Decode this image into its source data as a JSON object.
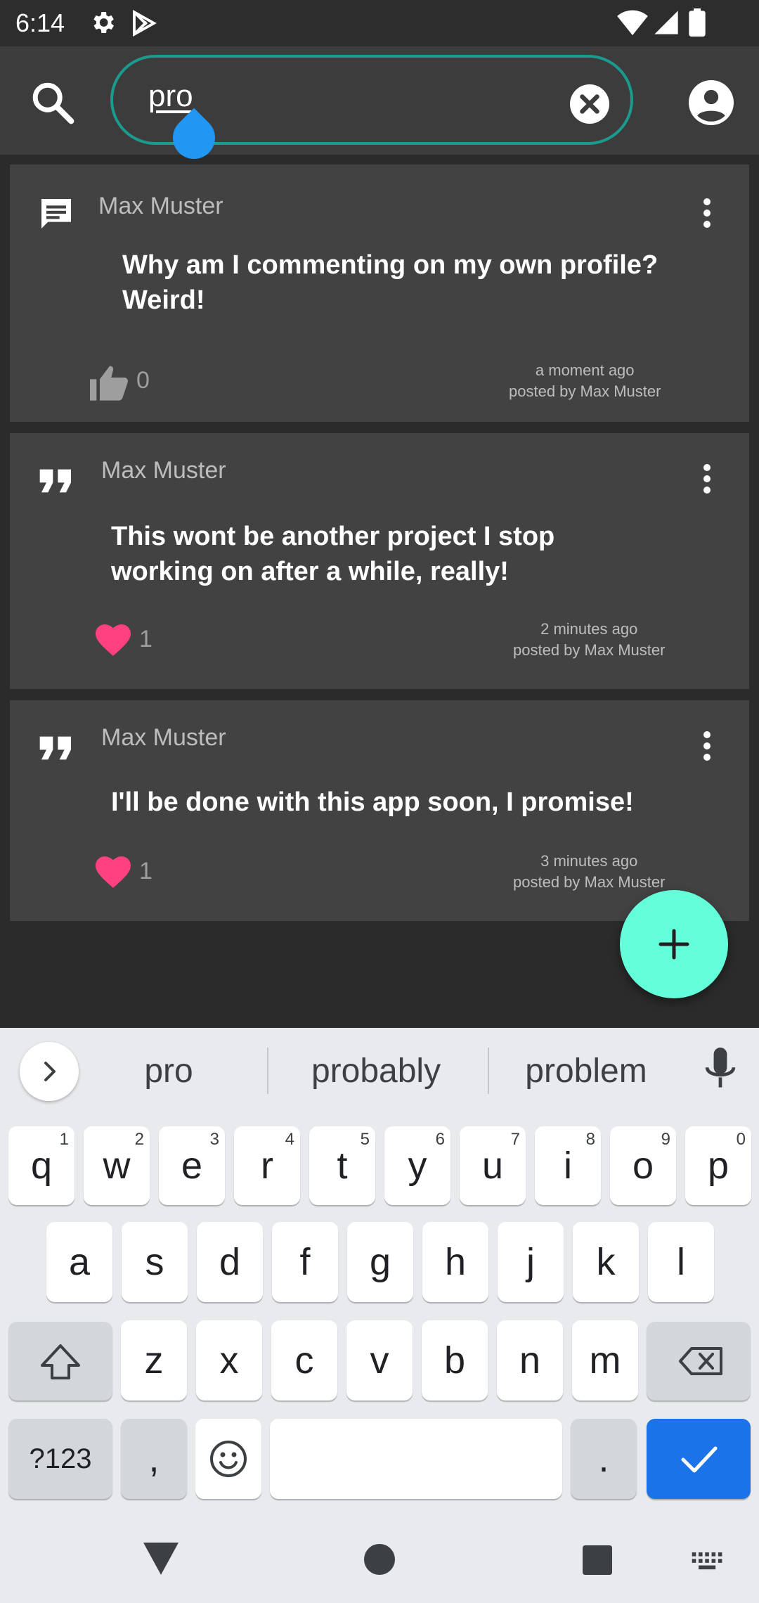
{
  "status_bar": {
    "time": "6:14"
  },
  "search": {
    "query": "pro"
  },
  "posts": [
    {
      "type_icon": "comment-icon",
      "author": "Max Muster",
      "body_line1": "Why am I commenting on my own profile?",
      "body_line2": "Weird!",
      "reaction_icon": "thumb-up-icon",
      "reaction_count": "0",
      "time_ago": "a moment ago",
      "posted_by": "posted by Max Muster"
    },
    {
      "type_icon": "quote-icon",
      "author": "Max Muster",
      "body_line1": "This wont be another project I stop",
      "body_line2": "working on after a while, really!",
      "reaction_icon": "heart-icon",
      "reaction_count": "1",
      "time_ago": "2 minutes ago",
      "posted_by": "posted by Max Muster"
    },
    {
      "type_icon": "quote-icon",
      "author": "Max Muster",
      "body_line1": "I'll be done with this app soon, I promise!",
      "reaction_icon": "heart-icon",
      "reaction_count": "1",
      "time_ago": "3 minutes ago",
      "posted_by": "posted by Max Muster"
    }
  ],
  "colors": {
    "accent": "#64ffda",
    "search_border": "#1b9a8e",
    "heart": "#ff4081",
    "card_bg": "#424242",
    "keyboard_action": "#1a73e8"
  },
  "keyboard": {
    "suggestions": [
      "pro",
      "probably",
      "problem"
    ],
    "row1": [
      {
        "key": "q",
        "hint": "1"
      },
      {
        "key": "w",
        "hint": "2"
      },
      {
        "key": "e",
        "hint": "3"
      },
      {
        "key": "r",
        "hint": "4"
      },
      {
        "key": "t",
        "hint": "5"
      },
      {
        "key": "y",
        "hint": "6"
      },
      {
        "key": "u",
        "hint": "7"
      },
      {
        "key": "i",
        "hint": "8"
      },
      {
        "key": "o",
        "hint": "9"
      },
      {
        "key": "p",
        "hint": "0"
      }
    ],
    "row2": [
      "a",
      "s",
      "d",
      "f",
      "g",
      "h",
      "j",
      "k",
      "l"
    ],
    "row3": [
      "z",
      "x",
      "c",
      "v",
      "b",
      "n",
      "m"
    ],
    "symbols_label": "?123",
    "comma": ",",
    "period": "."
  }
}
